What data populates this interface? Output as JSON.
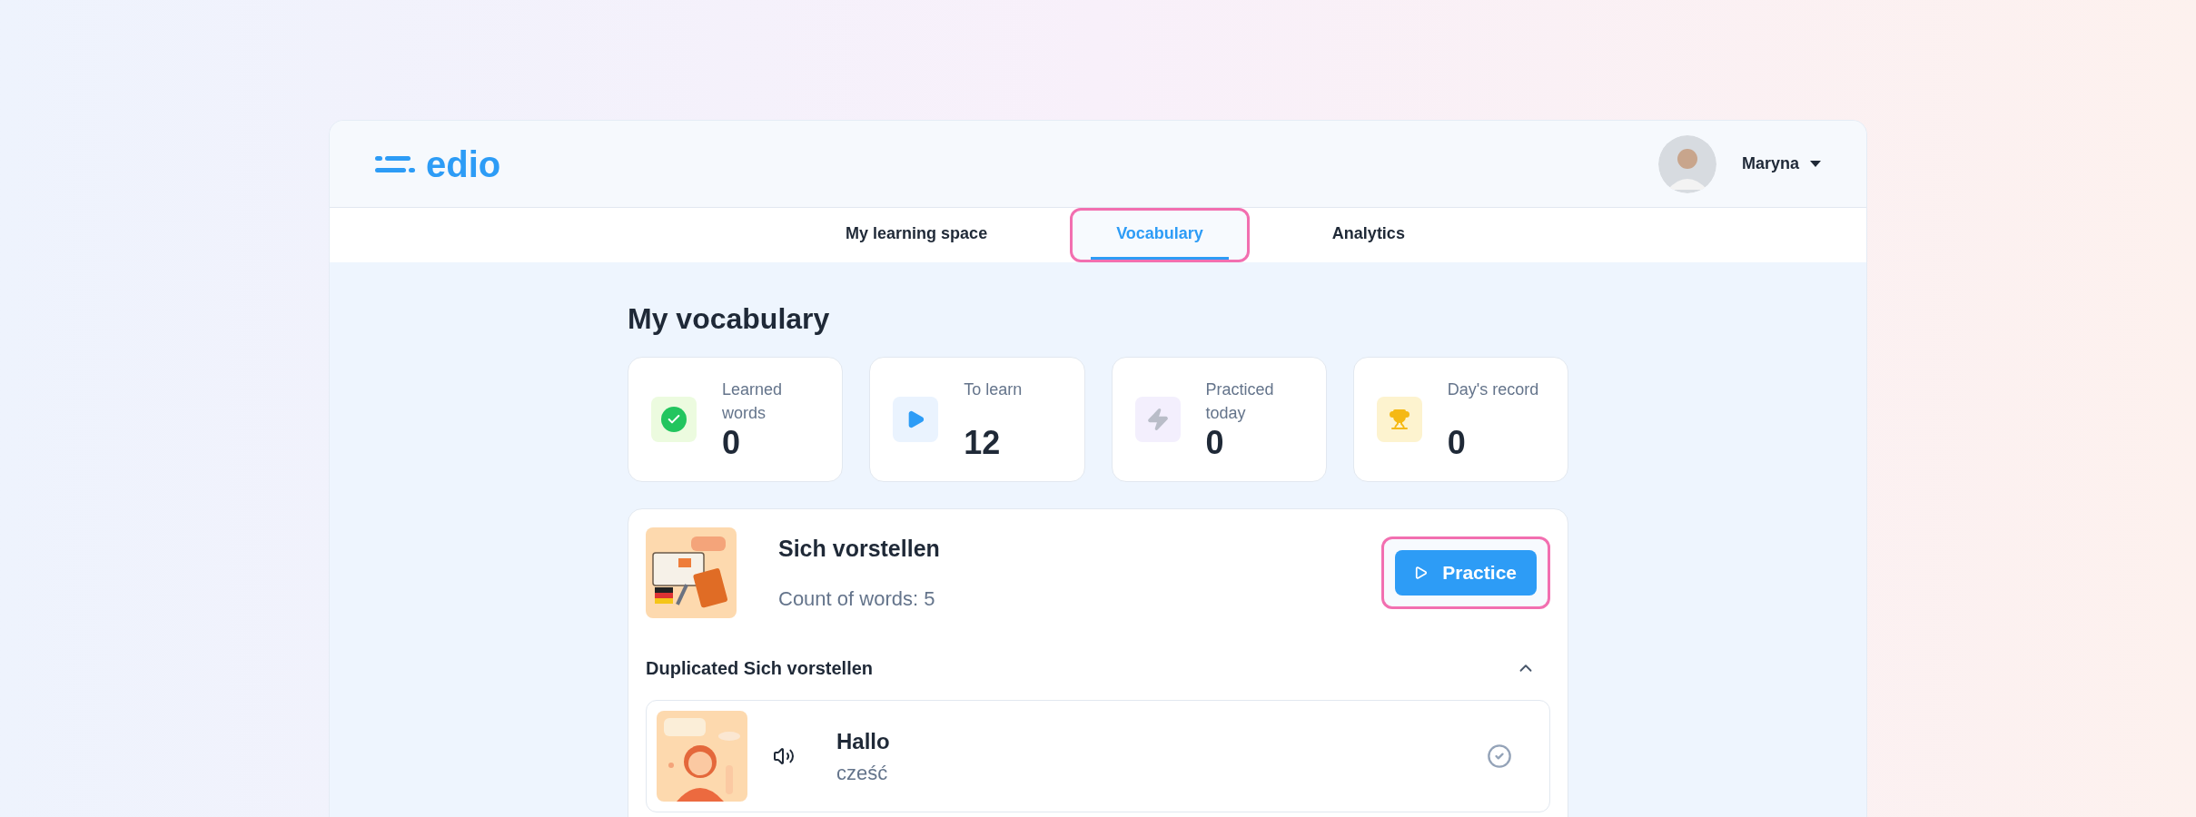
{
  "header": {
    "logo": "edio",
    "user": {
      "name": "Maryna"
    }
  },
  "tabs": [
    {
      "label": "My learning space",
      "selected": false,
      "highlighted": false
    },
    {
      "label": "Vocabulary",
      "selected": true,
      "highlighted": true
    },
    {
      "label": "Analytics",
      "selected": false,
      "highlighted": false
    }
  ],
  "page_title": "My vocabulary",
  "stats": [
    {
      "kind": "learned",
      "label": "Learned words",
      "value": "0"
    },
    {
      "kind": "to_learn",
      "label": "To learn",
      "value": "12"
    },
    {
      "kind": "practiced",
      "label": "Practiced today",
      "value": "0"
    },
    {
      "kind": "record",
      "label": "Day's record",
      "value": "0"
    }
  ],
  "lesson": {
    "title": "Sich vorstellen",
    "count": "Count of words: 5",
    "practice_button": {
      "label": "Practice",
      "highlighted": true
    },
    "section": {
      "title": "Duplicated Sich vorstellen",
      "expanded": true,
      "words": [
        {
          "word": "Hallo",
          "translation": "cześć",
          "learned": false
        }
      ]
    }
  }
}
